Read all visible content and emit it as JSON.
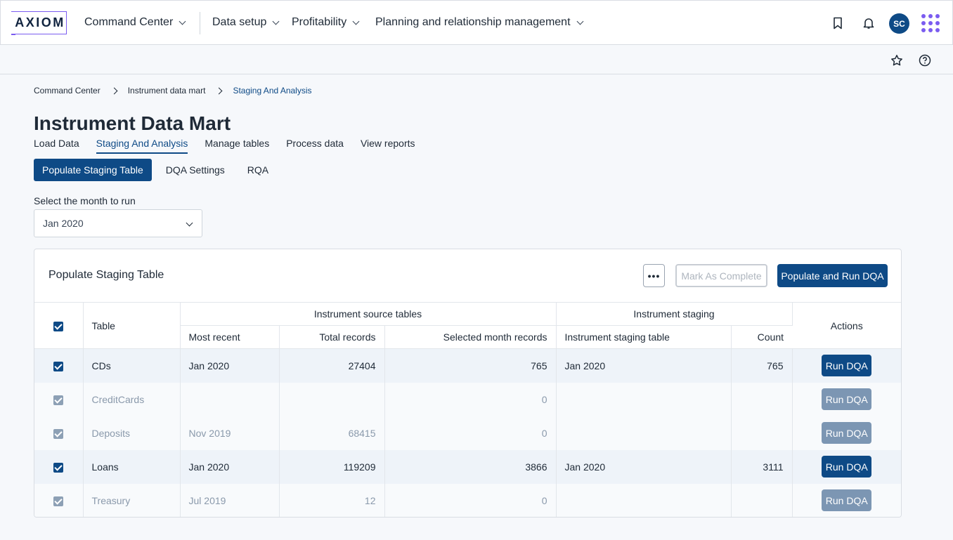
{
  "brand": {
    "logo_text": "AXIOM"
  },
  "topnav": {
    "items": [
      {
        "label": "Command Center"
      },
      {
        "label": "Data setup"
      },
      {
        "label": "Profitability"
      },
      {
        "label": "Planning and relationship management"
      }
    ],
    "user_initials": "SC"
  },
  "breadcrumb": [
    "Command Center",
    "Instrument data mart",
    "Staging And Analysis"
  ],
  "page": {
    "title": "Instrument Data Mart",
    "tabs": [
      "Load Data",
      "Staging And Analysis",
      "Manage tables",
      "Process data",
      "View reports"
    ],
    "active_tab": "Staging And Analysis",
    "subtabs": [
      "Populate Staging Table",
      "DQA Settings",
      "RQA"
    ],
    "active_subtab": "Populate Staging Table"
  },
  "month": {
    "label": "Select the month to run",
    "value": "Jan 2020"
  },
  "card": {
    "title": "Populate Staging Table",
    "more_label": "•••",
    "mark_complete_label": "Mark As Complete",
    "populate_label": "Populate and Run DQA"
  },
  "table": {
    "headers": {
      "table": "Table",
      "group_source": "Instrument source tables",
      "group_staging": "Instrument staging",
      "actions": "Actions",
      "most_recent": "Most recent",
      "total_records": "Total records",
      "selected_month_records": "Selected month records",
      "staging_table": "Instrument staging table",
      "count": "Count"
    },
    "rows": [
      {
        "name": "CDs",
        "most_recent": "Jan 2020",
        "total": "27404",
        "selected": "765",
        "staging": "Jan 2020",
        "count": "765",
        "action": "Run DQA"
      },
      {
        "name": "CreditCards",
        "most_recent": "",
        "total": "",
        "selected": "0",
        "staging": "",
        "count": "",
        "action": "Run DQA"
      },
      {
        "name": "Deposits",
        "most_recent": "Nov 2019",
        "total": "68415",
        "selected": "0",
        "staging": "",
        "count": "",
        "action": "Run DQA"
      },
      {
        "name": "Loans",
        "most_recent": "Jan 2020",
        "total": "119209",
        "selected": "3866",
        "staging": "Jan 2020",
        "count": "3111",
        "action": "Run DQA"
      },
      {
        "name": "Treasury",
        "most_recent": "Jul 2019",
        "total": "12",
        "selected": "0",
        "staging": "",
        "count": "",
        "action": "Run DQA"
      }
    ]
  },
  "colors": {
    "primary": "#0e4a86",
    "accent": "#7b5cf0"
  }
}
